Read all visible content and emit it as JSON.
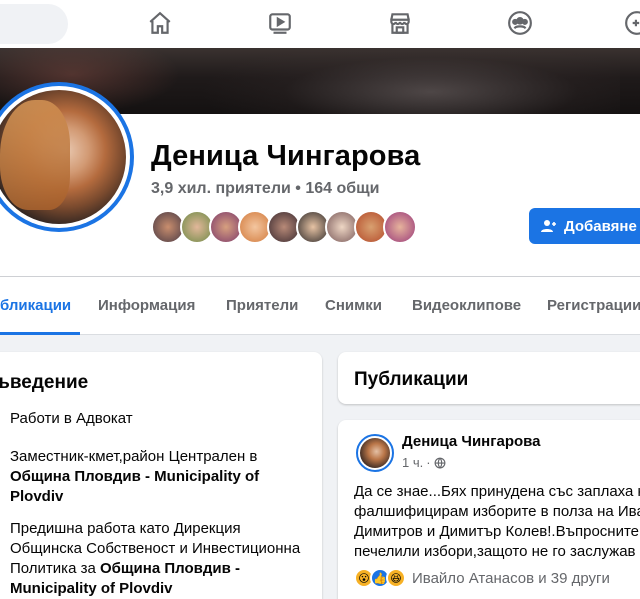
{
  "nav": {
    "icons": [
      "home-icon",
      "watch-icon",
      "marketplace-icon",
      "groups-icon",
      "gaming-icon"
    ]
  },
  "profile": {
    "name": "Деница Чингарова",
    "friends_summary": "3,9 хил. приятели • 164 общи",
    "add_button_label": "Добавяне"
  },
  "tabs": [
    {
      "label": "бликации",
      "active": true
    },
    {
      "label": "Информация",
      "active": false
    },
    {
      "label": "Приятели",
      "active": false
    },
    {
      "label": "Снимки",
      "active": false
    },
    {
      "label": "Видеоклипове",
      "active": false
    },
    {
      "label": "Регистрации",
      "active": false
    }
  ],
  "intro": {
    "title": "ъведение",
    "work": "Работи в Адвокат",
    "current_job_prefix": "Заместник-кмет,район Централен в",
    "current_job_org": "Община Пловдив - Municipality of Plovdiv",
    "current_job_org_line1": "Община Пловдив - Municipality of",
    "current_job_org_line2": "Plovdiv",
    "past_job_line1": "Предишна работа като Дирекция",
    "past_job_line2": "Общинска Собственост и Инвестиционна",
    "past_job_line3_prefix": "Политика за ",
    "past_job_line3_org": "Община Пловдив -",
    "past_job_line4": "Municipality of Plovdiv"
  },
  "posts": {
    "title": "Публикации",
    "items": [
      {
        "author": "Деница Чингарова",
        "time": "1 ч.",
        "privacy_icon": "globe-icon",
        "text_lines": [
          "Да се знае...Бях принудена със заплаха кт",
          "фалшифицирам изборите в полза на Ива",
          "Димитров и Димитър Колев!.Въпросните",
          "печелили избори,защото  не го заслужав"
        ],
        "reactions": [
          "wow",
          "like",
          "haha"
        ],
        "reactions_summary": "Ивайло Атанасов и 39 други"
      }
    ]
  },
  "colors": {
    "accent": "#1b74e4",
    "background": "#f0f2f5",
    "secondary_text": "#65676b"
  }
}
